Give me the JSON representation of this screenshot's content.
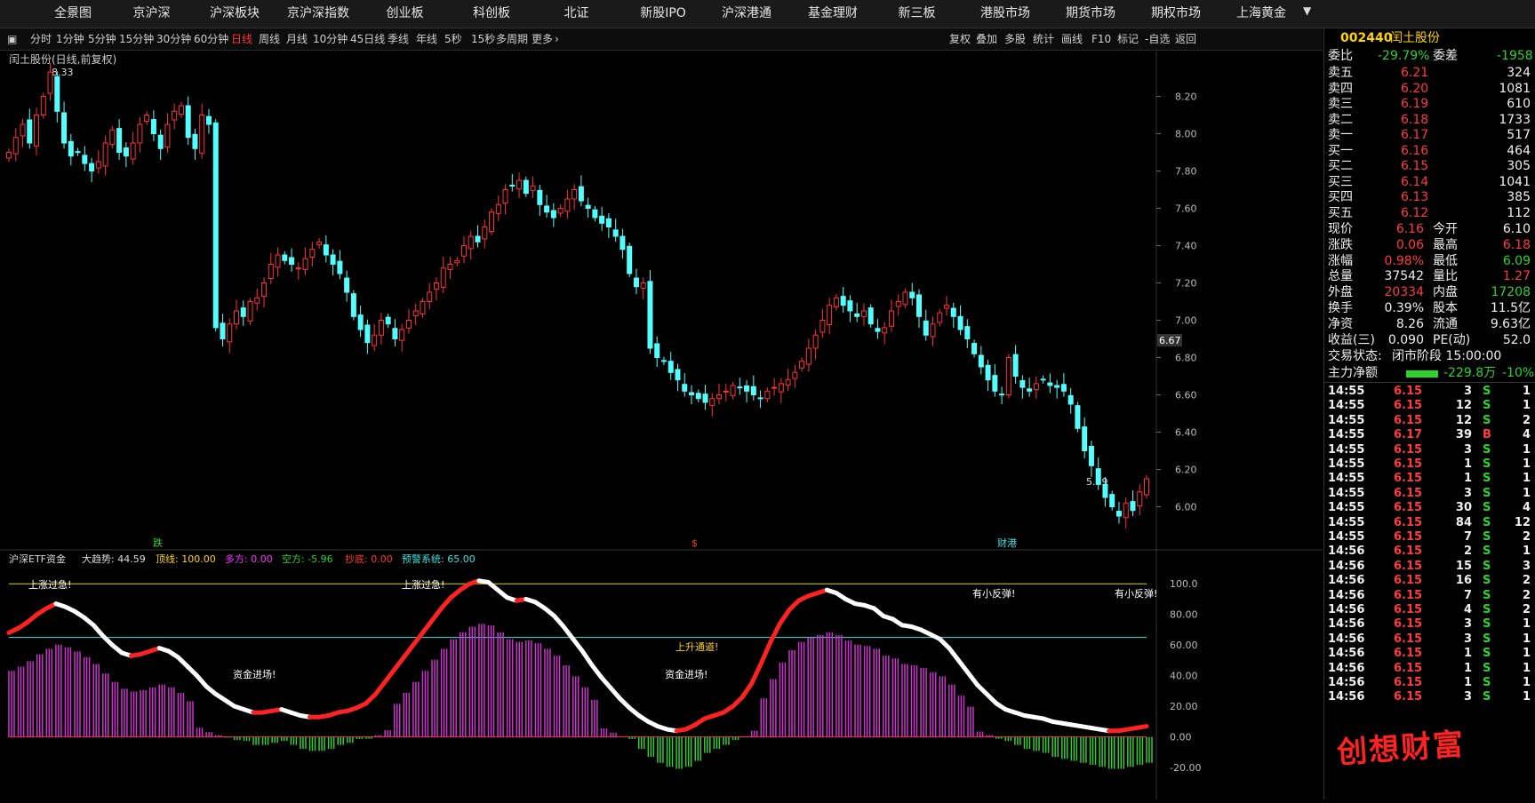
{
  "topnav": [
    "全景图",
    "京沪深",
    "沪深板块",
    "京沪深指数",
    "创业板",
    "科创板",
    "北证",
    "新股IPO",
    "沪深港通",
    "基金理财",
    "新三板",
    "港股市场",
    "期货市场",
    "期权市场",
    "上海黄金"
  ],
  "periods": [
    "分时",
    "1分钟",
    "5分钟",
    "15分钟",
    "30分钟",
    "60分钟",
    "日线",
    "周线",
    "月线",
    "10分钟",
    "45日线",
    "季线",
    "年线",
    "5秒",
    "15秒",
    "多周期",
    "更多"
  ],
  "active_period": "日线",
  "tools": [
    "复权",
    "叠加",
    "多股",
    "统计",
    "画线",
    "F10",
    "标记",
    "-自选",
    "返回"
  ],
  "chart": {
    "title": "闰土股份(日线,前复权)",
    "high_label": "8.33",
    "low_label": "5.89",
    "last_price_tag": "6.67",
    "event_marks": [
      "跌",
      "$",
      "财港"
    ],
    "price_axis": [
      "8.20",
      "8.00",
      "7.80",
      "7.60",
      "7.40",
      "7.20",
      "7.00",
      "6.80",
      "6.60",
      "6.40",
      "6.20",
      "6.00"
    ]
  },
  "chart_data": {
    "type": "candlestick",
    "ylim": [
      5.85,
      8.35
    ],
    "closes": [
      7.9,
      7.98,
      8.05,
      7.95,
      8.1,
      8.2,
      8.33,
      8.12,
      7.95,
      7.88,
      7.9,
      7.84,
      7.8,
      7.85,
      7.95,
      8.02,
      7.9,
      7.88,
      7.95,
      8.05,
      8.1,
      8.0,
      7.92,
      8.05,
      8.12,
      8.15,
      7.98,
      7.92,
      8.1,
      8.05,
      6.96,
      6.9,
      6.98,
      7.05,
      7.02,
      7.1,
      7.12,
      7.2,
      7.3,
      7.35,
      7.32,
      7.3,
      7.28,
      7.33,
      7.38,
      7.42,
      7.35,
      7.3,
      7.25,
      7.15,
      7.02,
      6.95,
      6.88,
      6.92,
      7.0,
      6.98,
      6.9,
      6.95,
      7.0,
      7.05,
      7.1,
      7.15,
      7.2,
      7.28,
      7.3,
      7.32,
      7.4,
      7.45,
      7.42,
      7.5,
      7.58,
      7.62,
      7.7,
      7.72,
      7.75,
      7.68,
      7.72,
      7.62,
      7.58,
      7.55,
      7.6,
      7.65,
      7.7,
      7.64,
      7.6,
      7.55,
      7.52,
      7.5,
      7.45,
      7.38,
      7.25,
      7.18,
      7.2,
      6.85,
      6.8,
      6.78,
      6.72,
      6.68,
      6.62,
      6.6,
      6.58,
      6.56,
      6.58,
      6.6,
      6.62,
      6.65,
      6.64,
      6.62,
      6.6,
      6.58,
      6.62,
      6.64,
      6.66,
      6.68,
      6.72,
      6.78,
      6.85,
      6.92,
      7.0,
      7.08,
      7.12,
      7.08,
      7.05,
      7.02,
      7.05,
      6.98,
      6.94,
      6.96,
      7.05,
      7.1,
      7.15,
      7.12,
      7.02,
      6.92,
      6.98,
      7.04,
      7.08,
      7.02,
      6.95,
      6.9,
      6.82,
      6.75,
      6.68,
      6.62,
      6.6,
      6.8,
      6.7,
      6.64,
      6.62,
      6.66,
      6.68,
      6.65,
      6.64,
      6.62,
      6.55,
      6.42,
      6.3,
      6.22,
      6.12,
      6.05,
      6.0,
      5.95,
      6.02,
      5.98,
      6.08,
      6.15
    ],
    "indicator": {
      "name": "沪深ETF资金",
      "values": {
        "大趋势": "44.59",
        "顶线": "100.00",
        "多方": "0.00",
        "空方": "-5.96",
        "抄底": "0.00",
        "预警系统": "65.00"
      },
      "ylim": [
        -35,
        110
      ],
      "axis": [
        "100.0",
        "80.00",
        "60.00",
        "40.00",
        "20.00",
        "0.00",
        "-20.00"
      ],
      "labels": [
        "上涨过急!",
        "上涨过急!",
        "资金进场!",
        "资金进场!",
        "上升通道!",
        "有小反弹!",
        "有小反弹!"
      ],
      "trend": [
        68,
        71,
        75,
        80,
        84,
        87,
        85,
        82,
        78,
        73,
        66,
        60,
        55,
        53,
        54,
        56,
        58,
        56,
        52,
        46,
        40,
        33,
        28,
        24,
        20,
        18,
        16,
        16,
        17,
        18,
        16,
        14,
        13,
        13,
        14,
        16,
        17,
        19,
        22,
        28,
        36,
        44,
        52,
        60,
        68,
        76,
        84,
        91,
        96,
        100,
        102,
        101,
        96,
        91,
        89,
        90,
        88,
        84,
        79,
        72,
        64,
        56,
        47,
        39,
        32,
        25,
        19,
        14,
        10,
        7,
        5,
        4,
        5,
        8,
        12,
        14,
        16,
        20,
        26,
        35,
        48,
        62,
        74,
        83,
        89,
        92,
        94,
        96,
        94,
        90,
        87,
        86,
        84,
        79,
        77,
        73,
        72,
        70,
        67,
        64,
        58,
        50,
        42,
        34,
        28,
        22,
        18,
        16,
        14,
        13,
        12,
        10,
        9,
        8,
        7,
        6,
        5,
        4,
        4,
        5,
        6,
        7
      ]
    }
  },
  "quote": {
    "code": "002440",
    "name": "闰土股份",
    "weibi_label": "委比",
    "weibi": "-29.79%",
    "weicha_label": "委差",
    "weicha": "-1958",
    "asks": [
      [
        "卖五",
        "6.21",
        "324"
      ],
      [
        "卖四",
        "6.20",
        "1081"
      ],
      [
        "卖三",
        "6.19",
        "610"
      ],
      [
        "卖二",
        "6.18",
        "1733"
      ],
      [
        "卖一",
        "6.17",
        "517"
      ]
    ],
    "bids": [
      [
        "买一",
        "6.16",
        "464"
      ],
      [
        "买二",
        "6.15",
        "305"
      ],
      [
        "买三",
        "6.14",
        "1041"
      ],
      [
        "买四",
        "6.13",
        "385"
      ],
      [
        "买五",
        "6.12",
        "112"
      ]
    ],
    "stats": [
      [
        "现价",
        "6.16",
        "今开",
        "6.10"
      ],
      [
        "涨跌",
        "0.06",
        "最高",
        "6.18"
      ],
      [
        "涨幅",
        "0.98%",
        "最低",
        "6.09"
      ],
      [
        "总量",
        "37542",
        "量比",
        "1.27"
      ],
      [
        "外盘",
        "20334",
        "内盘",
        "17208"
      ],
      [
        "换手",
        "0.39%",
        "股本",
        "11.5亿"
      ],
      [
        "净资",
        "8.26",
        "流通",
        "9.63亿"
      ],
      [
        "收益(三)",
        "0.090",
        "PE(动)",
        "52.0"
      ]
    ],
    "status_label": "交易状态:",
    "status": "闭市阶段 15:00:00",
    "flow_label": "主力净额",
    "flow_value": "-229.8万",
    "flow_pct": "-10%"
  },
  "trades": [
    [
      "14:55",
      "6.15",
      "3",
      "S",
      "1"
    ],
    [
      "14:55",
      "6.15",
      "12",
      "S",
      "1"
    ],
    [
      "14:55",
      "6.15",
      "12",
      "S",
      "2"
    ],
    [
      "14:55",
      "6.17",
      "39",
      "B",
      "4"
    ],
    [
      "14:55",
      "6.15",
      "3",
      "S",
      "1"
    ],
    [
      "14:55",
      "6.15",
      "1",
      "S",
      "1"
    ],
    [
      "14:55",
      "6.15",
      "1",
      "S",
      "1"
    ],
    [
      "14:55",
      "6.15",
      "3",
      "S",
      "1"
    ],
    [
      "14:55",
      "6.15",
      "30",
      "S",
      "4"
    ],
    [
      "14:55",
      "6.15",
      "84",
      "S",
      "12"
    ],
    [
      "14:55",
      "6.15",
      "7",
      "S",
      "2"
    ],
    [
      "14:56",
      "6.15",
      "2",
      "S",
      "1"
    ],
    [
      "14:56",
      "6.15",
      "15",
      "S",
      "3"
    ],
    [
      "14:56",
      "6.15",
      "16",
      "S",
      "2"
    ],
    [
      "14:56",
      "6.15",
      "7",
      "S",
      "2"
    ],
    [
      "14:56",
      "6.15",
      "4",
      "S",
      "2"
    ],
    [
      "14:56",
      "6.15",
      "3",
      "S",
      "1"
    ],
    [
      "14:56",
      "6.15",
      "3",
      "S",
      "1"
    ],
    [
      "14:56",
      "6.15",
      "1",
      "S",
      "1"
    ],
    [
      "14:56",
      "6.15",
      "1",
      "S",
      "1"
    ],
    [
      "14:56",
      "6.15",
      "1",
      "S",
      "1"
    ],
    [
      "14:56",
      "6.15",
      "3",
      "S",
      "1"
    ]
  ],
  "watermark": "创想财富"
}
